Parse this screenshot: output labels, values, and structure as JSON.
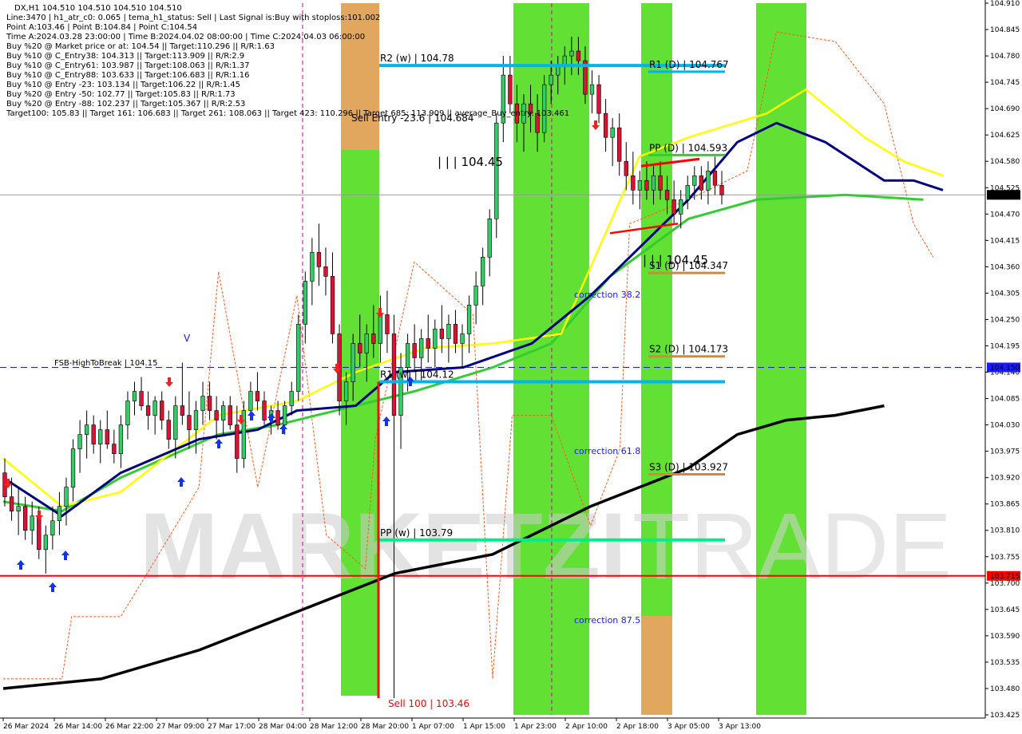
{
  "header": {
    "symbol_line": "DX,H1  104.510 104.510 104.510 104.510",
    "lines": [
      "Line:3470 | h1_atr_c0: 0.065 | tema_h1_status: Sell | Last Signal is:Buy with stoploss:101.002",
      "Point A:103.46 | Point B:104.84 | Point C:104.54",
      "Time A:2024.03.28 23:00:00 | Time B:2024.04.02 08:00:00 | Time C:2024.04.03 06:00:00",
      "Buy %20 @ Market price or at: 104.54 || Target:110.296 || R/R:1.63",
      "Buy %10 @ C_Entry38: 104.313 || Target:113.909 || R/R:2.9",
      "Buy %10 @ C_Entry61: 103.987 || Target:108.063 || R/R:1.37",
      "Buy %10 @ C_Entry88: 103.633 || Target:106.683 || R/R:1.16",
      "Buy %10 @ Entry -23: 103.134 || Target:106.22 || R/R:1.45",
      "Buy %20 @ Entry -50: 102.77 || Target:105.83 || R/R:1.73",
      "Buy %20 @ Entry -88: 102.237 || Target:105.367 || R/R:2.53",
      "Target100: 105.83 || Target 161: 106.683 || Target 261: 108.063 || Target 423: 110.296 || Target 685: 113.909 || average_Buy_entry: 103.461"
    ]
  },
  "watermark": {
    "part1": "MARKETZI",
    "part2": "TRADE"
  },
  "chart_data": {
    "type": "candlestick",
    "ylim": [
      103.425,
      104.91
    ],
    "y_ticks": [
      "104.910",
      "104.845",
      "104.780",
      "104.745",
      "104.690",
      "104.625",
      "104.580",
      "104.525",
      "104.470",
      "104.415",
      "104.360",
      "104.305",
      "104.250",
      "104.195",
      "104.140",
      "104.085",
      "104.030",
      "103.975",
      "103.920",
      "103.865",
      "103.810",
      "103.755",
      "103.700",
      "103.645",
      "103.590",
      "103.535",
      "103.480",
      "103.425"
    ],
    "x_ticks": [
      "26 Mar 2024",
      "26 Mar 14:00",
      "26 Mar 22:00",
      "27 Mar 09:00",
      "27 Mar 17:00",
      "28 Mar 04:00",
      "28 Mar 12:00",
      "28 Mar 20:00",
      "1 Apr 07:00",
      "1 Apr 15:00",
      "1 Apr 23:00",
      "2 Apr 10:00",
      "2 Apr 18:00",
      "3 Apr 05:00",
      "3 Apr 13:00"
    ],
    "price_tags": [
      {
        "label": "104.510",
        "value": 104.51,
        "color": "#000000"
      },
      {
        "label": "104.150",
        "value": 104.15,
        "color": "#1a1aff"
      },
      {
        "label": "103.715",
        "value": 103.715,
        "color": "#ff0000"
      }
    ],
    "levels": [
      {
        "label": "R2 (w) | 104.78",
        "value": 104.78,
        "color": "#00b4f0"
      },
      {
        "label": "R1 (w) | 104.12",
        "value": 104.12,
        "color": "#00b4f0"
      },
      {
        "label": "PP (w) | 103.79",
        "value": 103.79,
        "color": "#00ee88"
      },
      {
        "label": "R1 (D) | 104.767",
        "value": 104.767,
        "color": "#00b4f0"
      },
      {
        "label": "PP (D) | 104.593",
        "value": 104.593,
        "color": "#33cc33"
      },
      {
        "label": "S1 (D) | 104.347",
        "value": 104.347,
        "color": "#d4883a"
      },
      {
        "label": "S2 (D) | 104.173",
        "value": 104.173,
        "color": "#d4883a"
      },
      {
        "label": "S3 (D) | 103.927",
        "value": 103.927,
        "color": "#d4883a"
      }
    ],
    "annotations": {
      "fsb": "FSB-HighToBreak | 104.15",
      "sell_entry": "Sell Entry -23.6 | 104.684",
      "iii_upper": "| | | 104.45",
      "iii_lower": "| | | 104.45",
      "sell100": "Sell 100 | 103.46",
      "corr38": "correction 38.2",
      "corr61": "correction 61.8",
      "corr87": "correction 87.5",
      "v_mark": "V"
    },
    "candles": [
      [
        103.93,
        103.96,
        103.86,
        103.88
      ],
      [
        103.88,
        103.92,
        103.83,
        103.85
      ],
      [
        103.85,
        103.9,
        103.8,
        103.86
      ],
      [
        103.86,
        103.88,
        103.79,
        103.81
      ],
      [
        103.81,
        103.87,
        103.78,
        103.84
      ],
      [
        103.84,
        103.86,
        103.75,
        103.77
      ],
      [
        103.77,
        103.82,
        103.72,
        103.8
      ],
      [
        103.8,
        103.86,
        103.77,
        103.83
      ],
      [
        103.83,
        103.89,
        103.8,
        103.86
      ],
      [
        103.86,
        103.92,
        103.82,
        103.9
      ],
      [
        103.9,
        104.0,
        103.87,
        103.98
      ],
      [
        103.98,
        104.04,
        103.93,
        104.01
      ],
      [
        104.01,
        104.06,
        103.96,
        104.03
      ],
      [
        104.03,
        104.05,
        103.97,
        103.99
      ],
      [
        103.99,
        104.04,
        103.95,
        104.02
      ],
      [
        104.02,
        104.06,
        103.98,
        103.99
      ],
      [
        103.99,
        104.02,
        103.95,
        103.97
      ],
      [
        103.97,
        104.05,
        103.94,
        104.03
      ],
      [
        104.03,
        104.1,
        104.0,
        104.08
      ],
      [
        104.08,
        104.12,
        104.05,
        104.1
      ],
      [
        104.1,
        104.13,
        104.06,
        104.07
      ],
      [
        104.07,
        104.1,
        104.02,
        104.05
      ],
      [
        104.05,
        104.09,
        104.01,
        104.08
      ],
      [
        104.08,
        104.1,
        104.02,
        104.04
      ],
      [
        104.04,
        104.06,
        103.98,
        104.0
      ],
      [
        104.0,
        104.09,
        103.96,
        104.07
      ],
      [
        104.07,
        104.16,
        104.03,
        104.05
      ],
      [
        104.05,
        104.1,
        103.98,
        104.02
      ],
      [
        104.02,
        104.08,
        103.97,
        104.06
      ],
      [
        104.06,
        104.12,
        104.03,
        104.09
      ],
      [
        104.09,
        104.12,
        104.04,
        104.06
      ],
      [
        104.06,
        104.09,
        104.0,
        104.04
      ],
      [
        104.04,
        104.08,
        104.01,
        104.07
      ],
      [
        104.07,
        104.09,
        104.02,
        104.03
      ],
      [
        104.03,
        104.07,
        103.93,
        103.96
      ],
      [
        103.96,
        104.08,
        103.94,
        104.06
      ],
      [
        104.06,
        104.12,
        104.04,
        104.1
      ],
      [
        104.1,
        104.14,
        104.06,
        104.08
      ],
      [
        104.08,
        104.1,
        104.03,
        104.04
      ],
      [
        104.04,
        104.07,
        104.01,
        104.06
      ],
      [
        104.06,
        104.08,
        104.02,
        104.03
      ],
      [
        104.03,
        104.08,
        104.01,
        104.07
      ],
      [
        104.07,
        104.12,
        104.05,
        104.1
      ],
      [
        104.1,
        104.26,
        104.08,
        104.24
      ],
      [
        104.24,
        104.35,
        104.2,
        104.33
      ],
      [
        104.33,
        104.42,
        104.28,
        104.39
      ],
      [
        104.39,
        104.45,
        104.32,
        104.36
      ],
      [
        104.36,
        104.4,
        104.3,
        104.34
      ],
      [
        104.34,
        104.39,
        104.2,
        104.22
      ],
      [
        104.22,
        104.24,
        104.05,
        104.08
      ],
      [
        104.08,
        104.14,
        104.03,
        104.12
      ],
      [
        104.12,
        104.22,
        104.08,
        104.2
      ],
      [
        104.2,
        104.26,
        104.15,
        104.18
      ],
      [
        104.18,
        104.24,
        104.12,
        104.22
      ],
      [
        104.22,
        104.28,
        104.17,
        104.2
      ],
      [
        104.2,
        104.3,
        104.16,
        104.26
      ],
      [
        104.26,
        104.31,
        104.18,
        104.22
      ],
      [
        104.22,
        104.26,
        103.46,
        104.05
      ],
      [
        104.05,
        104.18,
        103.98,
        104.15
      ],
      [
        104.15,
        104.22,
        104.1,
        104.2
      ],
      [
        104.2,
        104.24,
        104.14,
        104.17
      ],
      [
        104.17,
        104.23,
        104.12,
        104.21
      ],
      [
        104.21,
        104.26,
        104.16,
        104.19
      ],
      [
        104.19,
        104.25,
        104.15,
        104.23
      ],
      [
        104.23,
        104.28,
        104.18,
        104.21
      ],
      [
        104.21,
        104.26,
        104.16,
        104.24
      ],
      [
        104.24,
        104.27,
        104.18,
        104.2
      ],
      [
        104.2,
        104.24,
        104.15,
        104.22
      ],
      [
        104.22,
        104.3,
        104.18,
        104.28
      ],
      [
        104.28,
        104.35,
        104.24,
        104.32
      ],
      [
        104.32,
        104.4,
        104.28,
        104.38
      ],
      [
        104.38,
        104.48,
        104.34,
        104.46
      ],
      [
        104.46,
        104.68,
        104.42,
        104.66
      ],
      [
        104.66,
        104.8,
        104.62,
        104.76
      ],
      [
        104.76,
        104.8,
        104.68,
        104.7
      ],
      [
        104.7,
        104.74,
        104.62,
        104.66
      ],
      [
        104.66,
        104.72,
        104.6,
        104.7
      ],
      [
        104.7,
        104.74,
        104.64,
        104.68
      ],
      [
        104.68,
        104.72,
        104.6,
        104.64
      ],
      [
        104.64,
        104.76,
        104.62,
        104.74
      ],
      [
        104.74,
        104.79,
        104.7,
        104.76
      ],
      [
        104.76,
        104.8,
        104.72,
        104.78
      ],
      [
        104.78,
        104.82,
        104.74,
        104.8
      ],
      [
        104.8,
        104.84,
        104.76,
        104.81
      ],
      [
        104.81,
        104.84,
        104.76,
        104.79
      ],
      [
        104.79,
        104.82,
        104.7,
        104.72
      ],
      [
        104.72,
        104.77,
        104.68,
        104.74
      ],
      [
        104.74,
        104.76,
        104.66,
        104.68
      ],
      [
        104.68,
        104.71,
        104.6,
        104.63
      ],
      [
        104.63,
        104.67,
        104.57,
        104.65
      ],
      [
        104.65,
        104.68,
        104.55,
        104.58
      ],
      [
        104.58,
        104.62,
        104.52,
        104.55
      ],
      [
        104.55,
        104.6,
        104.49,
        104.52
      ],
      [
        104.52,
        104.56,
        104.48,
        104.54
      ],
      [
        104.54,
        104.58,
        104.5,
        104.52
      ],
      [
        104.52,
        104.57,
        104.49,
        104.55
      ],
      [
        104.55,
        104.58,
        104.5,
        104.52
      ],
      [
        104.52,
        104.55,
        104.47,
        104.5
      ],
      [
        104.5,
        104.54,
        104.45,
        104.47
      ],
      [
        104.47,
        104.52,
        104.44,
        104.5
      ],
      [
        104.5,
        104.55,
        104.48,
        104.53
      ],
      [
        104.53,
        104.57,
        104.5,
        104.55
      ],
      [
        104.55,
        104.57,
        104.5,
        104.52
      ],
      [
        104.52,
        104.58,
        104.49,
        104.56
      ],
      [
        104.56,
        104.59,
        104.51,
        104.53
      ],
      [
        104.53,
        104.56,
        104.49,
        104.51
      ]
    ],
    "ma_black": [
      [
        0,
        103.48
      ],
      [
        0.1,
        103.5
      ],
      [
        0.2,
        103.56
      ],
      [
        0.3,
        103.64
      ],
      [
        0.4,
        103.72
      ],
      [
        0.5,
        103.76
      ],
      [
        0.6,
        103.86
      ],
      [
        0.7,
        103.94
      ],
      [
        0.75,
        104.01
      ],
      [
        0.8,
        104.04
      ],
      [
        0.85,
        104.05
      ],
      [
        0.9,
        104.07
      ]
    ],
    "ma_navy": [
      [
        0,
        103.92
      ],
      [
        0.06,
        103.84
      ],
      [
        0.12,
        103.93
      ],
      [
        0.2,
        104.0
      ],
      [
        0.26,
        104.02
      ],
      [
        0.3,
        104.06
      ],
      [
        0.36,
        104.07
      ],
      [
        0.4,
        104.14
      ],
      [
        0.47,
        104.15
      ],
      [
        0.54,
        104.2
      ],
      [
        0.6,
        104.3
      ],
      [
        0.7,
        104.5
      ],
      [
        0.75,
        104.62
      ],
      [
        0.79,
        104.66
      ],
      [
        0.84,
        104.62
      ],
      [
        0.9,
        104.54
      ],
      [
        0.93,
        104.54
      ],
      [
        0.96,
        104.52
      ]
    ],
    "ma_yellow": [
      [
        0,
        103.96
      ],
      [
        0.06,
        103.86
      ],
      [
        0.12,
        103.89
      ],
      [
        0.22,
        104.05
      ],
      [
        0.3,
        104.08
      ],
      [
        0.36,
        104.14
      ],
      [
        0.43,
        104.19
      ],
      [
        0.5,
        104.2
      ],
      [
        0.57,
        104.22
      ],
      [
        0.65,
        104.59
      ],
      [
        0.7,
        104.63
      ],
      [
        0.78,
        104.68
      ],
      [
        0.82,
        104.73
      ],
      [
        0.88,
        104.63
      ],
      [
        0.92,
        104.58
      ],
      [
        0.96,
        104.55
      ]
    ],
    "ma_green": [
      [
        0,
        103.87
      ],
      [
        0.06,
        103.85
      ],
      [
        0.12,
        103.92
      ],
      [
        0.22,
        104.01
      ],
      [
        0.28,
        104.03
      ],
      [
        0.36,
        104.07
      ],
      [
        0.42,
        104.1
      ],
      [
        0.5,
        104.15
      ],
      [
        0.56,
        104.2
      ],
      [
        0.62,
        104.34
      ],
      [
        0.7,
        104.46
      ],
      [
        0.77,
        104.5
      ],
      [
        0.86,
        104.51
      ],
      [
        0.94,
        104.5
      ]
    ],
    "ma_red_dotted": [
      [
        0,
        103.5
      ],
      [
        0.06,
        103.5
      ],
      [
        0.07,
        103.63
      ],
      [
        0.12,
        103.63
      ],
      [
        0.15,
        103.73
      ],
      [
        0.2,
        103.9
      ],
      [
        0.22,
        104.35
      ],
      [
        0.26,
        103.9
      ],
      [
        0.3,
        104.3
      ],
      [
        0.33,
        103.8
      ],
      [
        0.37,
        103.73
      ],
      [
        0.38,
        104.0
      ],
      [
        0.42,
        104.37
      ],
      [
        0.48,
        104.26
      ],
      [
        0.5,
        103.5
      ],
      [
        0.52,
        104.05
      ],
      [
        0.56,
        104.05
      ],
      [
        0.6,
        103.82
      ],
      [
        0.63,
        103.98
      ],
      [
        0.64,
        104.45
      ],
      [
        0.7,
        104.5
      ],
      [
        0.76,
        104.56
      ],
      [
        0.79,
        104.85
      ],
      [
        0.85,
        104.83
      ],
      [
        0.9,
        104.7
      ],
      [
        0.93,
        104.45
      ],
      [
        0.95,
        104.38
      ]
    ]
  }
}
